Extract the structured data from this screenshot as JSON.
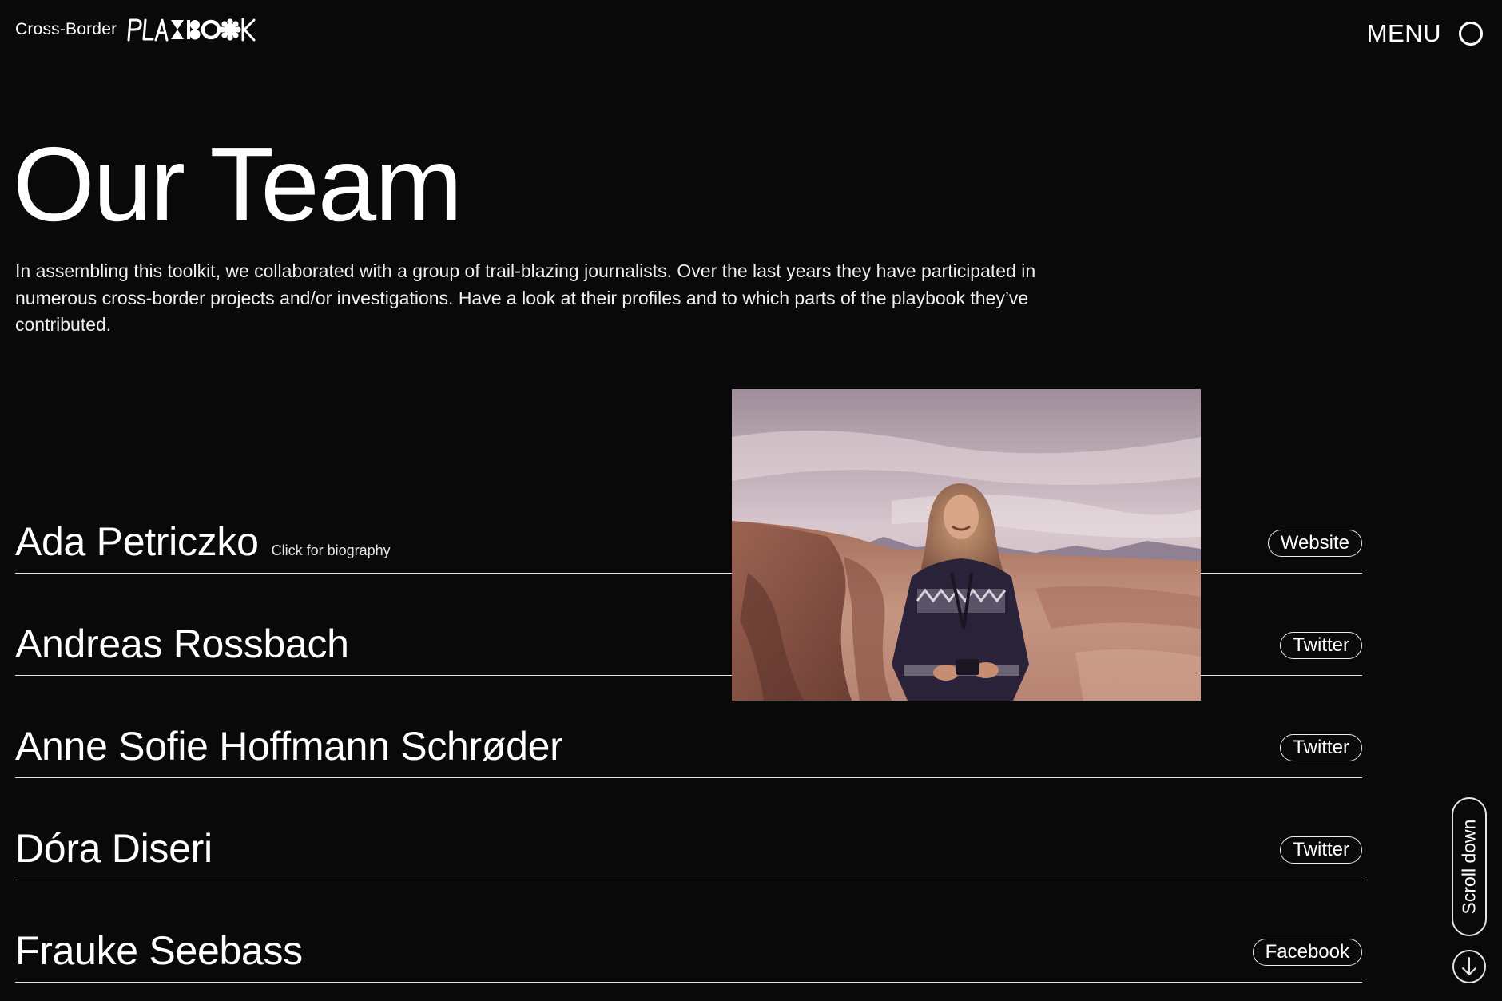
{
  "header": {
    "brand_prefix": "Cross-Border",
    "brand_logo_text": "PLAYBOOK",
    "menu_label": "MENU"
  },
  "page": {
    "title": "Our Team",
    "intro": "In assembling this toolkit, we collaborated with a group of trail-blazing journalists. Over the last years they have participated in numerous cross-border projects and/or investigations. Have a look at their profiles and to which parts of the playbook they’ve contributed."
  },
  "team": [
    {
      "name": "Ada Petriczko",
      "bio_hint": "Click for biography",
      "link_label": "Website"
    },
    {
      "name": "Andreas Rossbach",
      "bio_hint": "",
      "link_label": "Twitter"
    },
    {
      "name": "Anne Sofie Hoffmann Schrøder",
      "bio_hint": "",
      "link_label": "Twitter"
    },
    {
      "name": "Dóra Diseri",
      "bio_hint": "",
      "link_label": "Twitter"
    },
    {
      "name": "Frauke Seebass",
      "bio_hint": "",
      "link_label": "Facebook"
    }
  ],
  "scroll": {
    "label": "Scroll down"
  },
  "colors": {
    "background": "#0a0909",
    "text": "#ffffff",
    "rule": "#e7e2e0"
  }
}
